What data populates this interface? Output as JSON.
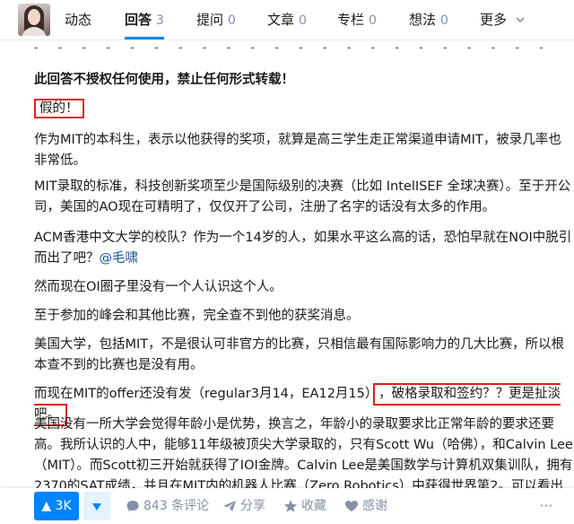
{
  "tabs": [
    {
      "label": "动态",
      "count": ""
    },
    {
      "label": "回答",
      "count": "3"
    },
    {
      "label": "提问",
      "count": "0"
    },
    {
      "label": "文章",
      "count": "0"
    },
    {
      "label": "专栏",
      "count": "0"
    },
    {
      "label": "想法",
      "count": "0"
    },
    {
      "label": "更多",
      "count": ""
    }
  ],
  "answer": {
    "separator": "- - - - - - - - - - - - - - - - - - - - - - - - - - - - - - -",
    "copyright": "此回答不授权任何使用，禁止任何形式转载！",
    "verdict": "假的！",
    "p1": "作为MIT的本科生，表示以他获得的奖项，就算是高三学生走正常渠道申请MIT，被录几率也非常低。",
    "p2": "MIT录取的标准，科技创新奖项至少是国际级别的决赛（比如 IntelISEF 全球决赛）。至于开公司，美国的AO现在可精明了，仅仅开了公司，注册了名字的话没有太多的作用。",
    "p3_text": "ACM香港中文大学的校队？作为一个14岁的人，如果水平这么高的话，恐怕早就在NOI中脱引而出了吧？",
    "p3_mention": "@毛啸",
    "p4": "然而现在OI圈子里没有一个人认识这个人。",
    "p5": "至于参加的峰会和其他比赛，完全查不到他的获奖消息。",
    "p6": "美国大学，包括MIT，不是很认可非官方的比赛，只相信最有国际影响力的几大比赛，所以根本查不到的比赛也是没有用。",
    "p7_text": "而现在MIT的offer还没有发（regular3月14，EA12月15）",
    "p7_boxed": "，破格录取和签约？？更是扯淡吧。",
    "p8": "美国没有一所大学会觉得年龄小是优势，换言之，年龄小的录取要求比正常年龄的要求还要高。我所认识的人中，能够11年级被顶尖大学录取的，只有Scott Wu（哈佛），和Calvin Lee（MIT）。而Scott初三开始就获得了IOI金牌。Calvin Lee是美国数学与计算机双集训队，拥有2370的SAT成绩，并且在MIT内的机器人比赛（Zero Robotics）中获得世界第2。可以看出"
  },
  "actions": {
    "vote_count": "▲ 3K",
    "comments": "843 条评论",
    "share": "分享",
    "favorite": "收藏",
    "thanks": "感谢",
    "more": "···"
  },
  "colors": {
    "accent": "#0084ff",
    "highlight_box": "#e02020",
    "muted": "#8590a6"
  }
}
